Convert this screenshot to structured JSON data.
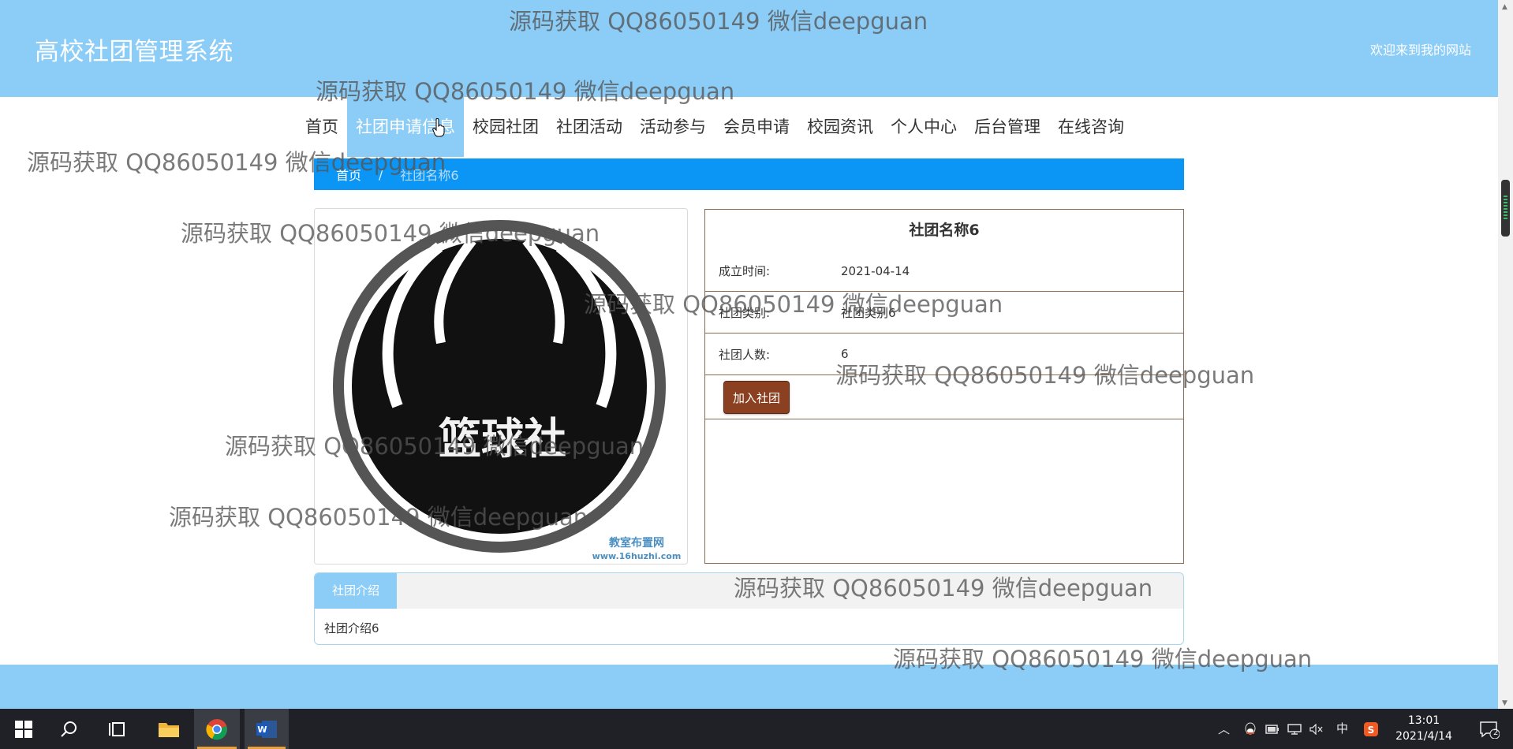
{
  "header": {
    "site_title": "高校社团管理系统",
    "welcome": "欢迎来到我的网站"
  },
  "nav": [
    "首页",
    "社团申请信息",
    "校园社团",
    "社团活动",
    "活动参与",
    "会员申请",
    "校园资讯",
    "个人中心",
    "后台管理",
    "在线咨询"
  ],
  "nav_active_index": 1,
  "breadcrumb": {
    "home": "首页",
    "separator": "/",
    "current": "社团名称6"
  },
  "club": {
    "name": "社团名称6",
    "image_text": "篮球社",
    "image_site_name": "教室布置网",
    "image_site_url": "www.16huzhi.com",
    "fields": [
      {
        "label": "成立时间:",
        "value": "2021-04-14"
      },
      {
        "label": "社团类别:",
        "value": "社团类别6"
      },
      {
        "label": "社团人数:",
        "value": "6"
      }
    ],
    "join_button": "加入社团"
  },
  "intro": {
    "tab": "社团介绍",
    "content": "社团介绍6"
  },
  "watermark": "源码获取 QQ86050149 微信deepguan",
  "taskbar": {
    "clock_time": "13:01",
    "clock_date": "2021/4/14",
    "ime": "中",
    "notification_count": "2"
  },
  "colors": {
    "header_bg": "#8ccdf8",
    "breadcrumb_bg": "#0b96f5",
    "join_button_bg": "#8b4022",
    "info_border": "#8a6a4e"
  }
}
